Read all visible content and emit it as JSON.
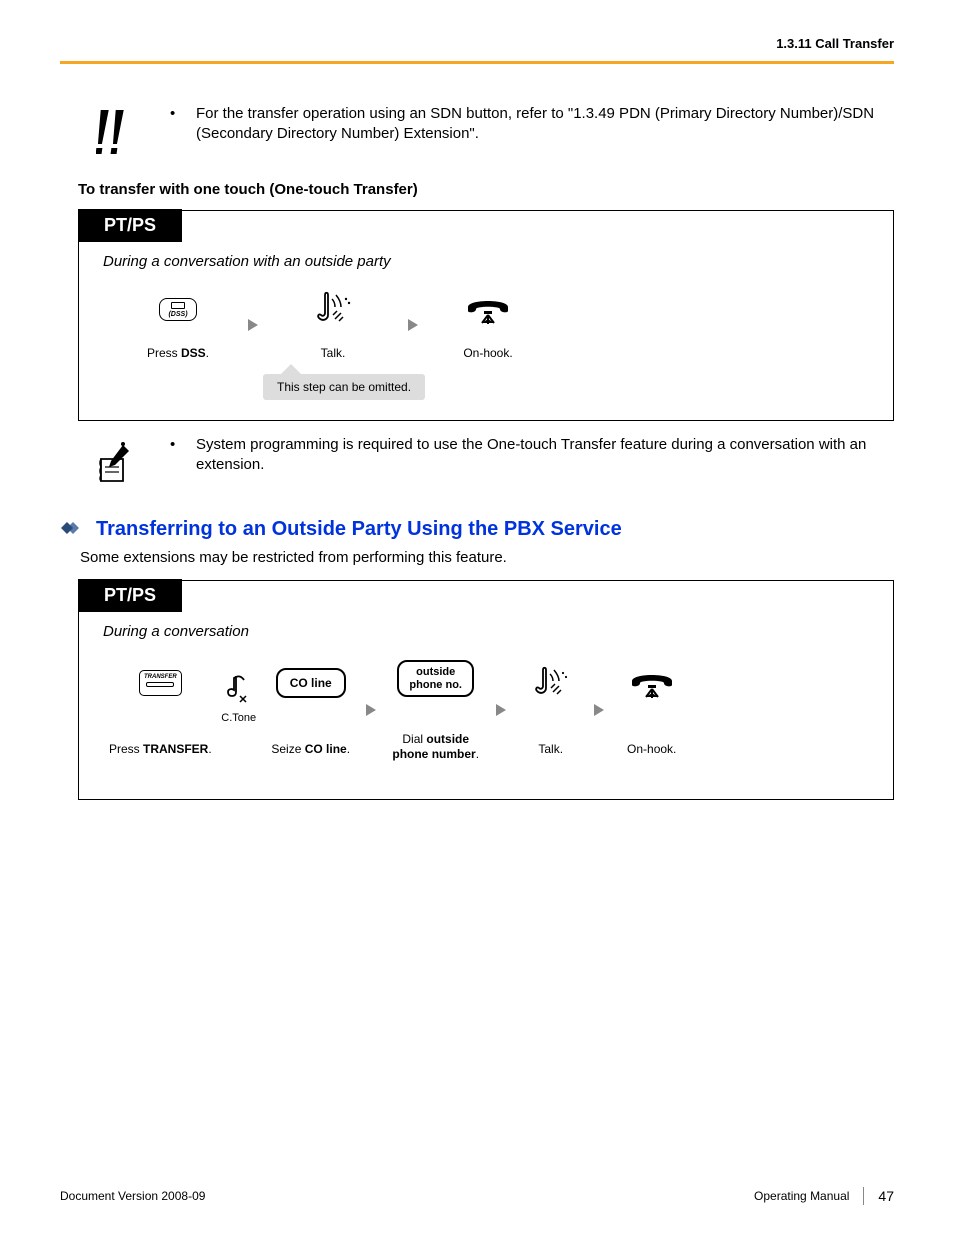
{
  "header": {
    "breadcrumb": "1.3.11 Call Transfer"
  },
  "exclaim_note": {
    "text": "For the transfer operation using an SDN button, refer to \"1.3.49  PDN (Primary Directory Number)/SDN (Secondary Directory Number) Extension\"."
  },
  "one_touch": {
    "heading": "To transfer with one touch (One-touch Transfer)",
    "tab": "PT/PS",
    "context": "During a conversation with an outside party",
    "steps": {
      "dss_key": "(DSS)",
      "dss_label_pre": "Press ",
      "dss_label_bold": "DSS",
      "dss_label_post": ".",
      "talk_label": "Talk.",
      "onhook_label": "On-hook."
    },
    "callout": "This step can be omitted."
  },
  "pencil_note": {
    "text": "System programming is required to use the One-touch Transfer feature during a conversation with an extension."
  },
  "outside_transfer": {
    "heading": "Transferring to an Outside Party Using the PBX Service",
    "desc": "Some extensions may be restricted from performing this feature.",
    "tab": "PT/PS",
    "context": "During a conversation",
    "steps": {
      "transfer_key": "TRANSFER",
      "transfer_label_pre": "Press ",
      "transfer_label_bold": "TRANSFER",
      "transfer_label_post": ".",
      "ctone": "C.Tone",
      "co_line": "CO line",
      "seize_pre": "Seize ",
      "seize_bold": "CO line",
      "seize_post": ".",
      "outside_btn_l1": "outside",
      "outside_btn_l2": "phone no.",
      "dial_pre": "Dial ",
      "dial_bold": "outside",
      "dial_l2_bold": "phone number",
      "dial_l2_post": ".",
      "talk_label": "Talk.",
      "onhook_label": "On-hook."
    }
  },
  "footer": {
    "left": "Document Version  2008-09",
    "right_label": "Operating Manual",
    "page": "47"
  }
}
